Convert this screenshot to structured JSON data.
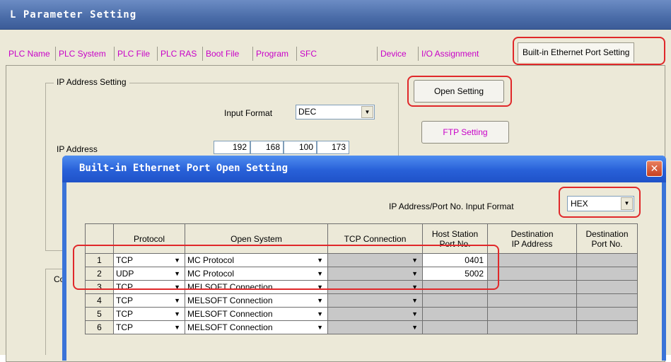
{
  "main_window": {
    "title": "L Parameter Setting"
  },
  "tabs": [
    {
      "label": "PLC Name",
      "active": false
    },
    {
      "label": "PLC System",
      "active": false
    },
    {
      "label": "PLC File",
      "active": false
    },
    {
      "label": "PLC RAS",
      "active": false
    },
    {
      "label": "Boot File",
      "active": false
    },
    {
      "label": "Program",
      "active": false
    },
    {
      "label": "SFC",
      "active": false
    },
    {
      "label": "Device",
      "active": false
    },
    {
      "label": "I/O Assignment",
      "active": false
    },
    {
      "label": "Built-in Ethernet Port Setting",
      "active": true
    }
  ],
  "ip_setting": {
    "group_label": "IP Address Setting",
    "input_format_label": "Input Format",
    "input_format_value": "DEC",
    "ip_address_label": "IP Address",
    "ip_octets": [
      "192",
      "168",
      "100",
      "173"
    ]
  },
  "buttons": {
    "open_setting": "Open Setting",
    "ftp_setting": "FTP Setting"
  },
  "partial_group_label": "Co",
  "dialog": {
    "title": "Built-in Ethernet Port Open Setting",
    "close_icon": "close-icon",
    "ip_format_label": "IP Address/Port No. Input Format",
    "ip_format_value": "HEX",
    "columns": {
      "protocol": "Protocol",
      "open_system": "Open System",
      "tcp_connection": "TCP Connection",
      "host_port_1": "Host Station",
      "host_port_2": "Port No.",
      "dest_ip_1": "Destination",
      "dest_ip_2": "IP Address",
      "dest_port_1": "Destination",
      "dest_port_2": "Port No."
    },
    "rows": [
      {
        "num": "1",
        "protocol": "TCP",
        "open_system": "MC Protocol",
        "host_port": "0401"
      },
      {
        "num": "2",
        "protocol": "UDP",
        "open_system": "MC Protocol",
        "host_port": "5002"
      },
      {
        "num": "3",
        "protocol": "TCP",
        "open_system": "MELSOFT Connection",
        "host_port": ""
      },
      {
        "num": "4",
        "protocol": "TCP",
        "open_system": "MELSOFT Connection",
        "host_port": ""
      },
      {
        "num": "5",
        "protocol": "TCP",
        "open_system": "MELSOFT Connection",
        "host_port": ""
      },
      {
        "num": "6",
        "protocol": "TCP",
        "open_system": "MELSOFT Connection",
        "host_port": ""
      }
    ]
  },
  "colors": {
    "highlight": "#e0282a",
    "tab_text": "#c800c8",
    "dialog_blue": "#2860d8"
  }
}
